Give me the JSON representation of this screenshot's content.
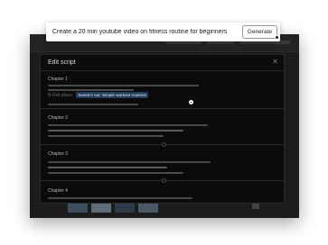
{
  "prompt": {
    "text": "Create a 20 min youtube video on fitness routine for beginners",
    "generate_label": "Generate"
  },
  "modal": {
    "title": "Edit script",
    "close_glyph": "✕",
    "chapters": [
      {
        "label": "Chapter 1",
        "bplace_label": "B-Roll place:",
        "bplace_value": "Sweat it out: Simple workout routines"
      },
      {
        "label": "Chapter 2"
      },
      {
        "label": "Chapter 3"
      },
      {
        "label": "Chapter 4"
      }
    ]
  },
  "colors": {
    "accent_chip": "#203a5c",
    "modal_bg": "#0b0b0b",
    "window_bg": "#1c1c1c"
  },
  "icons": {
    "close": "close-icon",
    "cursor": "cursor-icon"
  }
}
